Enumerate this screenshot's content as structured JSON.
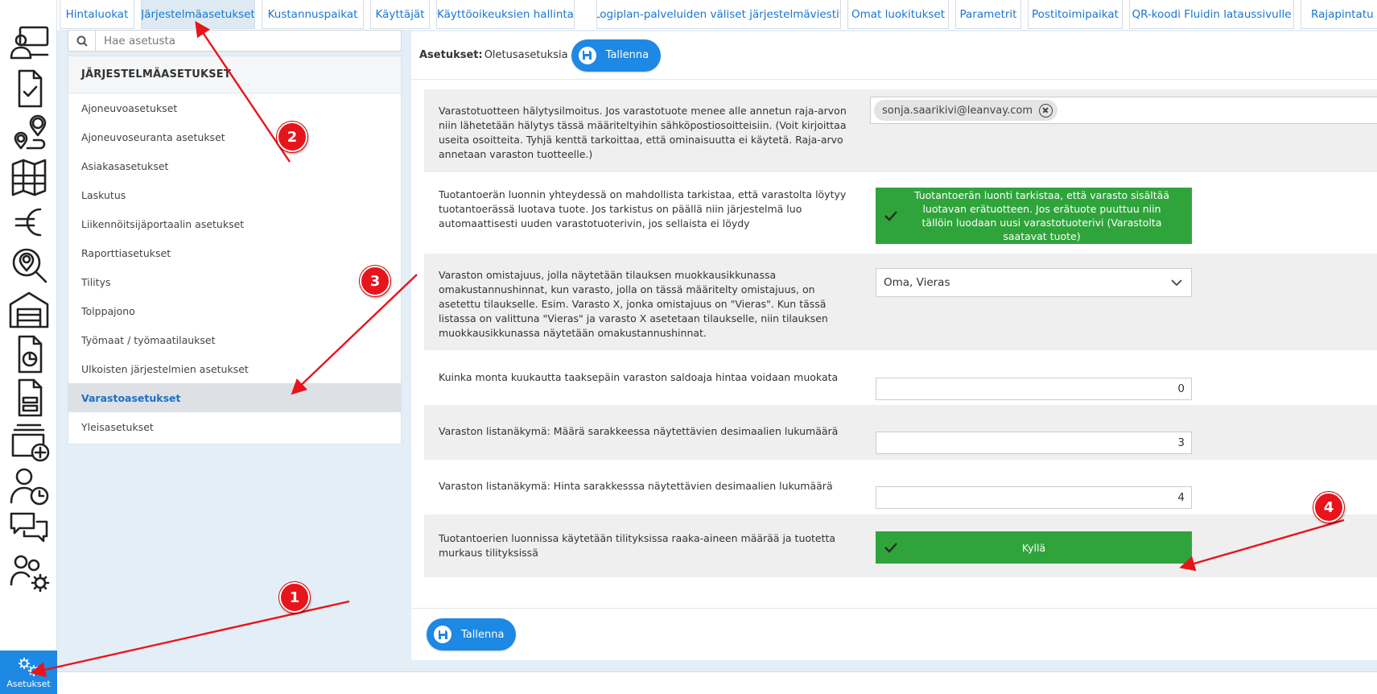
{
  "rail": {
    "icons": [
      "dispatch-desk-icon",
      "checklist-document-icon",
      "route-pins-icon",
      "map-icon",
      "euro-icon",
      "location-search-icon",
      "garage-icon",
      "report-document-icon",
      "form-document-icon",
      "add-stack-icon",
      "user-clock-icon",
      "chat-icon",
      "users-settings-icon"
    ],
    "settings_label": "Asetukset"
  },
  "tabs": [
    {
      "label": "Hintaluokat",
      "active": false
    },
    {
      "label": "Järjestelmäasetukset",
      "active": true
    },
    {
      "label": "Kustannuspaikat",
      "active": false
    },
    {
      "label": "Käyttäjät",
      "active": false
    },
    {
      "label": "Käyttöoikeuksien hallinta",
      "active": false
    },
    {
      "label": "Logiplan-palveluiden väliset järjestelmäviestit",
      "active": false
    },
    {
      "label": "Omat luokitukset",
      "active": false
    },
    {
      "label": "Parametrit",
      "active": false
    },
    {
      "label": "Postitoimipaikat",
      "active": false
    },
    {
      "label": "QR-koodi Fluidin lataussivulle",
      "active": false
    },
    {
      "label": "Rajapintatu",
      "active": false
    }
  ],
  "search": {
    "placeholder": "Hae asetusta",
    "value": ""
  },
  "menu": {
    "heading": "JÄRJESTELMÄASETUKSET",
    "items": [
      {
        "label": "Ajoneuvoasetukset"
      },
      {
        "label": "Ajoneuvoseuranta asetukset"
      },
      {
        "label": "Asiakasasetukset"
      },
      {
        "label": "Laskutus"
      },
      {
        "label": "Liikennöitsijäportaalin asetukset"
      },
      {
        "label": "Raporttiasetukset"
      },
      {
        "label": "Tilitys"
      },
      {
        "label": "Tolppajono"
      },
      {
        "label": "Työmaat / työmaatilaukset"
      },
      {
        "label": "Ulkoisten järjestelmien asetukset"
      },
      {
        "label": "Varastoasetukset",
        "active": true
      },
      {
        "label": "Yleisasetukset"
      }
    ]
  },
  "header": {
    "title": "Asetukset:",
    "subtitle": "Oletusasetuksia",
    "save_label": "Tallenna"
  },
  "settings": [
    {
      "description": "Varastotuotteen hälytysilmoitus. Jos varastotuote menee alle annetun raja-arvon niin lähetetään hälytys tässä määriteltyihin sähköpostiosoitteisiin. (Voit kirjoittaa useita osoitteita. Tyhjä kenttä tarkoittaa, että ominaisuutta ei käytetä. Raja-arvo annetaan varaston tuotteelle.)",
      "control": "chips",
      "value": "sonja.saarikivi@leanvay.com"
    },
    {
      "description": "Tuotantoerän luonnin yhteydessä on mahdollista tarkistaa, että varastolta löytyy tuotantoerässä luotava tuote. Jos tarkistus on päällä niin järjestelmä luo automaattisesti uuden varastotuoterivin, jos sellaista ei löydy",
      "control": "toggle",
      "value": "Tuotantoerän luonti tarkistaa, että varasto sisältää luotavan erätuotteen. Jos erätuote puuttuu niin tällöin luodaan uusi varastotuoterivi (Varastolta saatavat tuote)"
    },
    {
      "description": "Varaston omistajuus, jolla näytetään tilauksen muokkausikkunassa omakustannushinnat, kun varasto, jolla on tässä määritelty omistajuus, on asetettu tilaukselle. Esim. Varasto X, jonka omistajuus on \"Vieras\". Kun tässä listassa on valittuna \"Vieras\" ja varasto X asetetaan tilaukselle, niin tilauksen muokkausikkunassa näytetään omakustannushinnat.",
      "control": "select",
      "value": "Oma, Vieras"
    },
    {
      "description": "Kuinka monta kuukautta taaksepäin varaston saldoaja hintaa voidaan muokata",
      "control": "number",
      "value": "0"
    },
    {
      "description": "Varaston listanäkymä: Määrä sarakkeessa näytettävien desimaalien lukumäärä",
      "control": "number",
      "value": "3"
    },
    {
      "description": "Varaston listanäkymä: Hinta sarakkesssa näytettävien desimaalien lukumäärä",
      "control": "number",
      "value": "4"
    },
    {
      "description": "Tuotantoerien luonnissa käytetään tilityksissa raaka-aineen määrää ja tuotetta murkaus tilityksissä",
      "control": "toggle",
      "value": "Kyllä"
    }
  ],
  "footer": {
    "save_label": "Tallenna"
  },
  "annotations": {
    "markers": [
      "1",
      "2",
      "3",
      "4"
    ],
    "color": "#e8141b"
  },
  "colors": {
    "accent": "#1e88e5",
    "toggle_on": "#2fa43b",
    "active_tab": "#dde9f3"
  }
}
